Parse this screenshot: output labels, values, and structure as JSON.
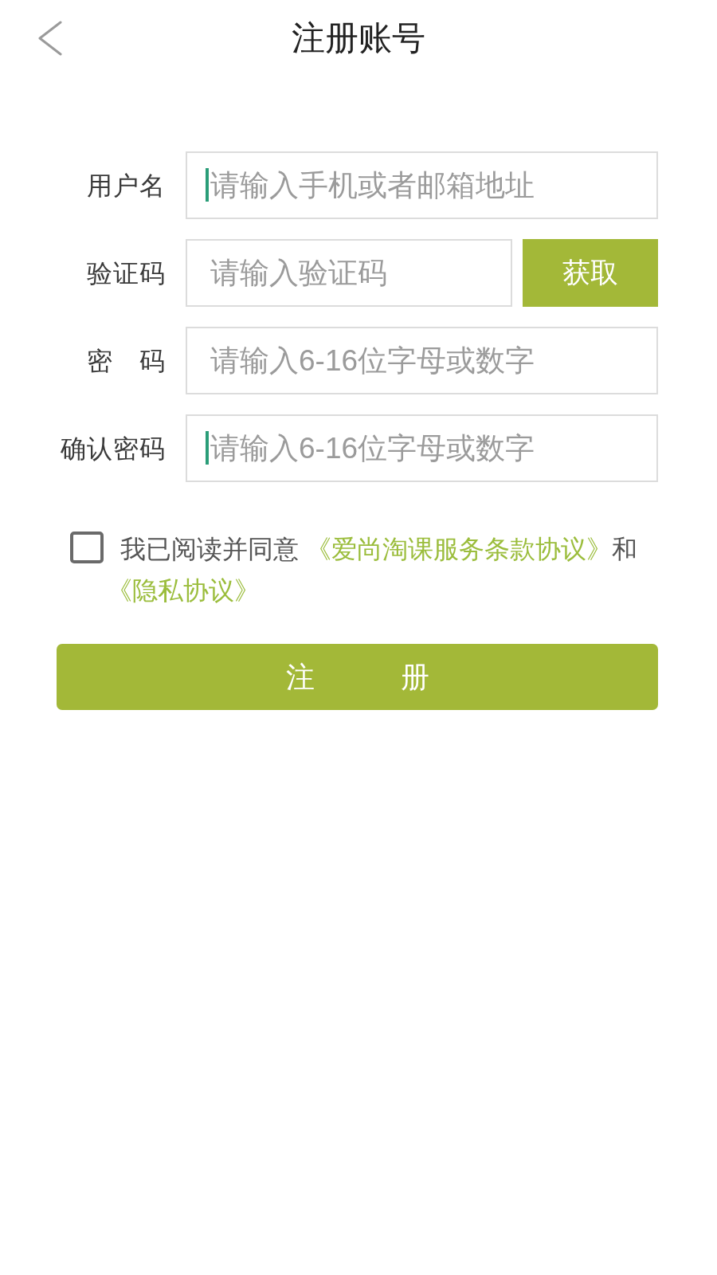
{
  "header": {
    "title": "注册账号"
  },
  "fields": [
    {
      "label": "用户名",
      "placeholder": "请输入手机或者邮箱地址",
      "caret": true
    },
    {
      "label": "验证码",
      "placeholder": "请输入验证码",
      "caret": false,
      "button": "获取"
    },
    {
      "label": "密　码",
      "placeholder": "请输入6-16位字母或数字",
      "caret": false
    },
    {
      "label": "确认密码",
      "placeholder": "请输入6-16位字母或数字",
      "caret": true
    }
  ],
  "agreement": {
    "checked": false,
    "parts": [
      {
        "kind": "plain",
        "text": "我已阅读并同意 "
      },
      {
        "kind": "link",
        "text": "《爱尚淘课服务条款协议》"
      },
      {
        "kind": "plain",
        "text": "和"
      },
      {
        "kind": "link",
        "text": "《隐私协议》"
      }
    ]
  },
  "submit": {
    "label": "注　　　册"
  }
}
